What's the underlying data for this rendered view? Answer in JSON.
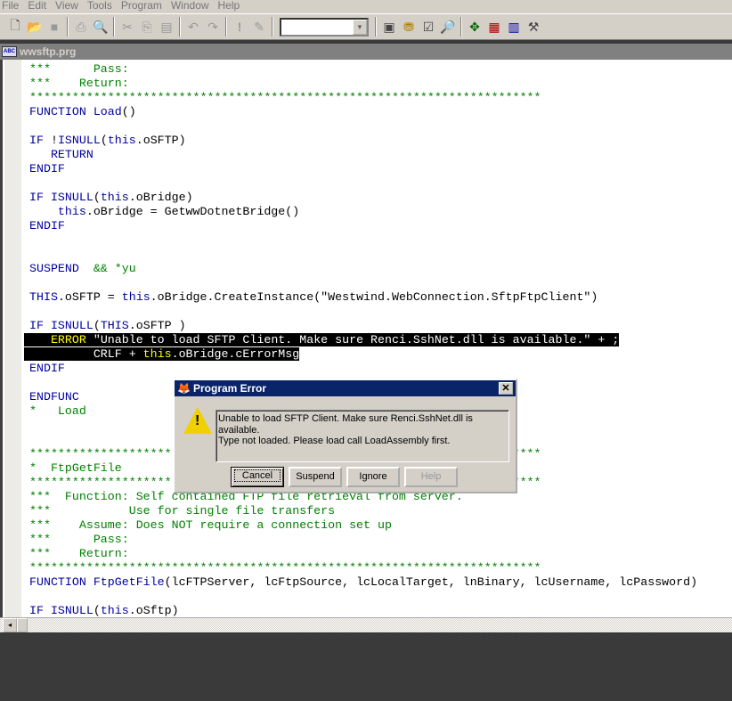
{
  "menu": [
    "File",
    "Edit",
    "View",
    "Tools",
    "Program",
    "Window",
    "Help"
  ],
  "toolbar": {
    "icons": [
      "new-file-icon",
      "open-folder-icon",
      "save-icon",
      "print-icon",
      "print-preview-icon",
      "cut-icon",
      "copy-icon",
      "paste-icon",
      "undo-icon",
      "redo-icon",
      "run-icon",
      "modify-icon",
      "command-window-icon",
      "view-icon",
      "properties-icon",
      "form-icon",
      "class-browser-icon",
      "data-session-icon",
      "form-designer-icon",
      "tools-icon"
    ],
    "combo_value": ""
  },
  "window": {
    "title": "wwsftp.prg"
  },
  "code": [
    [
      [
        "***      Pass:",
        "cm"
      ]
    ],
    [
      [
        "***    Return:",
        "cm"
      ]
    ],
    [
      [
        "************************************************************************",
        "cm"
      ]
    ],
    [
      [
        "FUNCTION ",
        "kw"
      ],
      [
        "Load",
        "kw"
      ],
      [
        "()",
        "tx"
      ]
    ],
    [],
    [
      [
        "IF ",
        "kw"
      ],
      [
        "!",
        "tx"
      ],
      [
        "ISNULL",
        "kw"
      ],
      [
        "(",
        "tx"
      ],
      [
        "this",
        "kw"
      ],
      [
        ".oSFTP)",
        "tx"
      ]
    ],
    [
      [
        "   RETURN",
        "kw"
      ]
    ],
    [
      [
        "ENDIF",
        "kw"
      ]
    ],
    [],
    [
      [
        "IF ",
        "kw"
      ],
      [
        "ISNULL",
        "kw"
      ],
      [
        "(",
        "tx"
      ],
      [
        "this",
        "kw"
      ],
      [
        ".oBridge)",
        "tx"
      ]
    ],
    [
      [
        "    this",
        "kw"
      ],
      [
        ".oBridge = GetwwDotnetBridge()",
        "tx"
      ]
    ],
    [
      [
        "ENDIF",
        "kw"
      ]
    ],
    [],
    [],
    [
      [
        "SUSPEND",
        "kw"
      ],
      [
        "  && *yu",
        "cm"
      ]
    ],
    [],
    [
      [
        "THIS",
        "kw"
      ],
      [
        ".oSFTP = ",
        "tx"
      ],
      [
        "this",
        "kw"
      ],
      [
        ".oBridge.CreateInstance(\"Westwind.WebConnection.SftpFtpClient\")",
        "tx"
      ]
    ],
    [],
    [
      [
        "IF ",
        "kw"
      ],
      [
        "ISNULL",
        "kw"
      ],
      [
        "(",
        "tx"
      ],
      [
        "THIS",
        "kw"
      ],
      [
        ".oSFTP )",
        "tx"
      ]
    ],
    [
      [
        "   ",
        "tx"
      ],
      [
        "ERROR",
        "kw"
      ],
      [
        " \"Unable to load SFTP Client. Make sure Renci.SshNet.dll is available.\" + ;",
        "tx"
      ]
    ],
    [
      [
        "         CRLF + ",
        "tx"
      ],
      [
        "this",
        "kw"
      ],
      [
        ".oBridge.cErrorMsg",
        "tx"
      ]
    ],
    [
      [
        "ENDIF",
        "kw"
      ]
    ],
    [],
    [
      [
        "ENDFUNC",
        "kw"
      ]
    ],
    [
      [
        "*   Load",
        "cm"
      ]
    ],
    [],
    [],
    [
      [
        "************************************************************************",
        "cm"
      ]
    ],
    [
      [
        "*  FtpGetFile",
        "cm"
      ]
    ],
    [
      [
        "************************************************************************",
        "cm"
      ]
    ],
    [
      [
        "***  Function: Self contained FTP file retrieval from server.",
        "cm"
      ]
    ],
    [
      [
        "***           Use for single file transfers",
        "cm"
      ]
    ],
    [
      [
        "***    Assume: Does NOT require a connection set up",
        "cm"
      ]
    ],
    [
      [
        "***      Pass:",
        "cm"
      ]
    ],
    [
      [
        "***    Return:",
        "cm"
      ]
    ],
    [
      [
        "************************************************************************",
        "cm"
      ]
    ],
    [
      [
        "FUNCTION ",
        "kw"
      ],
      [
        "FtpGetFile",
        "kw"
      ],
      [
        "(lcFTPServer, lcFtpSource, lcLocalTarget, lnBinary, lcUsername, lcPassword)",
        "tx"
      ]
    ],
    [],
    [
      [
        "IF ",
        "kw"
      ],
      [
        "ISNULL",
        "kw"
      ],
      [
        "(",
        "tx"
      ],
      [
        "this",
        "kw"
      ],
      [
        ".oSftp)",
        "tx"
      ]
    ]
  ],
  "highlighted_lines": [
    19,
    20
  ],
  "dialog": {
    "title": "Program Error",
    "close": "✕",
    "message_line1": "Unable to load SFTP Client. Make sure Renci.SshNet.dll is available.",
    "message_line2": "Type not loaded. Please load call LoadAssembly first.",
    "buttons": {
      "cancel": "Cancel",
      "suspend": "Suspend",
      "ignore": "Ignore",
      "help": "Help"
    }
  }
}
